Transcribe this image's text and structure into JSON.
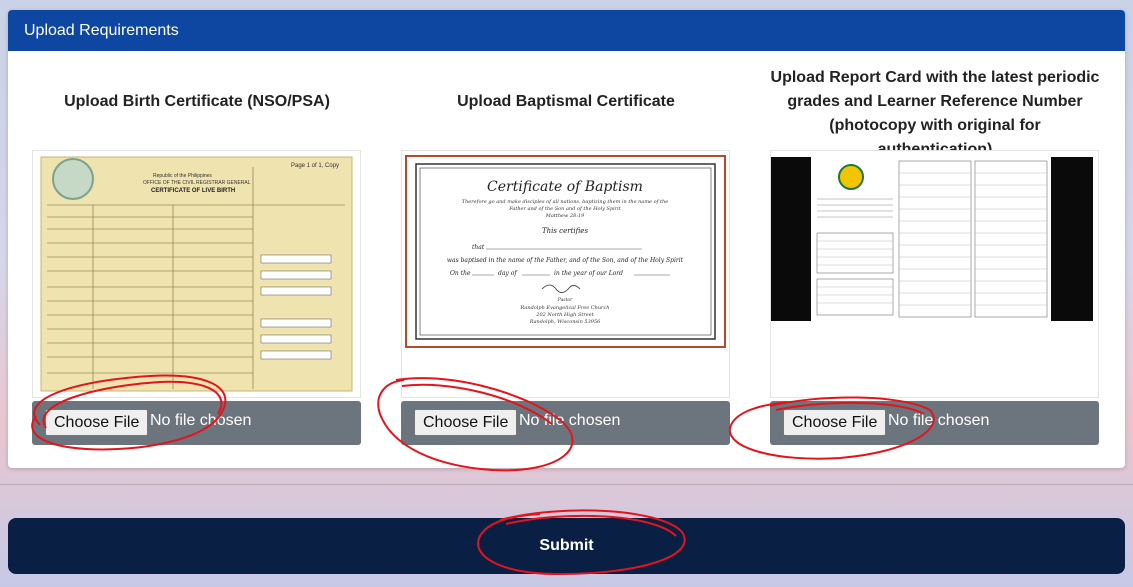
{
  "card": {
    "header": "Upload Requirements"
  },
  "uploads": [
    {
      "title": "Upload Birth Certificate (NSO/PSA)",
      "button": "Choose File",
      "status": "No file chosen",
      "preview": {
        "page": "Page 1 of 1, Copy",
        "republic": "Republic of the Philippines",
        "office": "OFFICE OF THE CIVIL REGISTRAR GENERAL",
        "heading": "CERTIFICATE OF LIVE BIRTH"
      }
    },
    {
      "title": "Upload Baptismal Certificate",
      "button": "Choose File",
      "status": "No file chosen",
      "preview": {
        "heading": "Certificate of Baptism",
        "verse1": "Therefore go and make disciples of all nations, baptizing them in the name of the",
        "verse2": "Father and of the Son and of the Holy Spirit",
        "ref": "Matthew 28:19",
        "certifies": "This certifies",
        "that": "that",
        "baptised": "was baptised in the name of the Father, and of the Son, and of the Holy Spirit",
        "on": "On the",
        "day": "day of",
        "year": "in the year of our Lord",
        "pastor": "Pastor",
        "church": "Randolph Evangelical Free Church",
        "street": "202 North High Street",
        "city": "Randolph, Wisconsin 53956"
      }
    },
    {
      "title_lines": [
        "Upload Report Card with the latest periodic",
        "grades and Learner Reference Number",
        "(photocopy with original for authentication)"
      ],
      "button": "Choose File",
      "status": "No file chosen"
    }
  ],
  "submit": {
    "label": "Submit"
  },
  "colors": {
    "header": "#0d47a1",
    "file_bar": "#6c757d",
    "submit": "#0a1f44",
    "annotation": "#e3141c"
  }
}
